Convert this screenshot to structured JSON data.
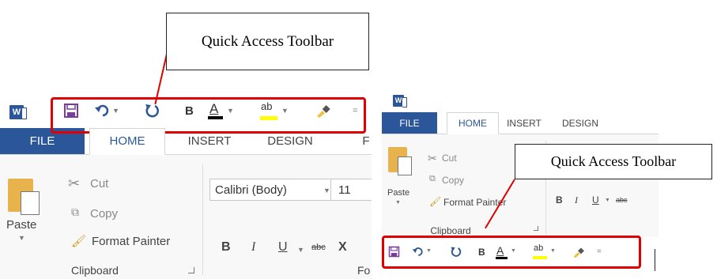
{
  "callouts": {
    "top": "Quick Access Toolbar",
    "right": "Quick Access Toolbar"
  },
  "colors": {
    "word_blue": "#2b579a",
    "highlight_red": "#e00000",
    "font_color_bar": "#000000",
    "highlight_bar": "#ffff00"
  },
  "left_window": {
    "app_icon": "W",
    "qat": {
      "save_icon": "save-icon",
      "undo_icon": "undo-icon",
      "redo_icon": "redo-icon",
      "bold": "B",
      "font_color": "A",
      "highlight": "ab",
      "format_painter_icon": "paintbrush-icon",
      "customize_icon": "customize-icon"
    },
    "tabs": [
      "FILE",
      "HOME",
      "INSERT",
      "DESIGN"
    ],
    "clipboard": {
      "paste": "Paste",
      "cut": "Cut",
      "copy": "Copy",
      "format_painter": "Format Painter",
      "group_label": "Clipboard"
    },
    "font": {
      "name": "Calibri (Body)",
      "size": "11",
      "bold": "B",
      "italic": "I",
      "underline": "U",
      "strike": "abc",
      "subscript": "X",
      "group_label_partial": "Fo"
    }
  },
  "right_window": {
    "app_icon": "W",
    "tabs": [
      "FILE",
      "HOME",
      "INSERT",
      "DESIGN"
    ],
    "clipboard": {
      "paste": "Paste",
      "cut": "Cut",
      "copy": "Copy",
      "format_painter": "Format Painter",
      "group_label": "Clipboard"
    },
    "font": {
      "bold": "B",
      "italic": "I",
      "underline": "U",
      "strike": "abc"
    },
    "qat": {
      "save_icon": "save-icon",
      "undo_icon": "undo-icon",
      "redo_icon": "redo-icon",
      "bold": "B",
      "font_color": "A",
      "highlight": "ab",
      "format_painter_icon": "paintbrush-icon",
      "customize_icon": "customize-icon"
    }
  }
}
